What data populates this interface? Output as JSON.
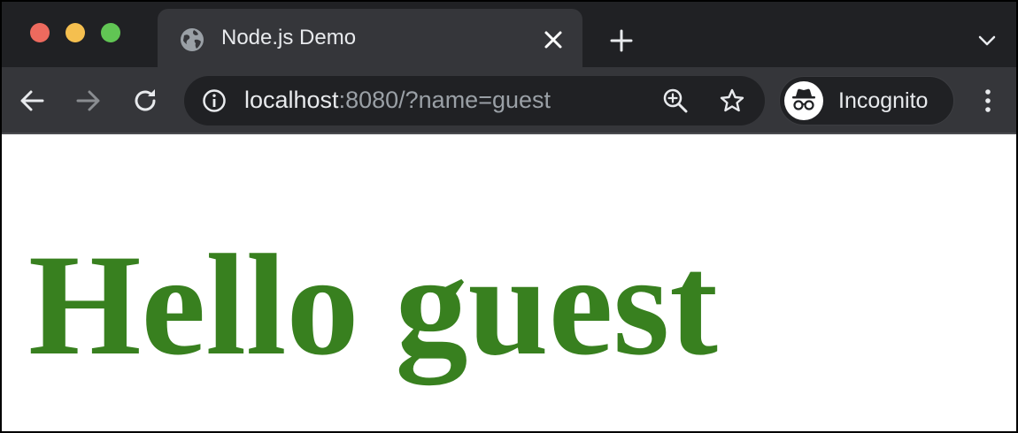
{
  "browser": {
    "tab": {
      "title": "Node.js Demo",
      "icon": "globe-icon"
    },
    "address_bar": {
      "host": "localhost",
      "rest": ":8080/?name=guest"
    },
    "profile": {
      "label": "Incognito",
      "icon": "incognito-icon"
    }
  },
  "page": {
    "heading": "Hello guest",
    "heading_color": "#38801f"
  },
  "colors": {
    "titlebar": "#202124",
    "toolbar": "#35363a",
    "traffic_close": "#ed6a5e",
    "traffic_minimize": "#f5bf4f",
    "traffic_maximize": "#61c554"
  }
}
